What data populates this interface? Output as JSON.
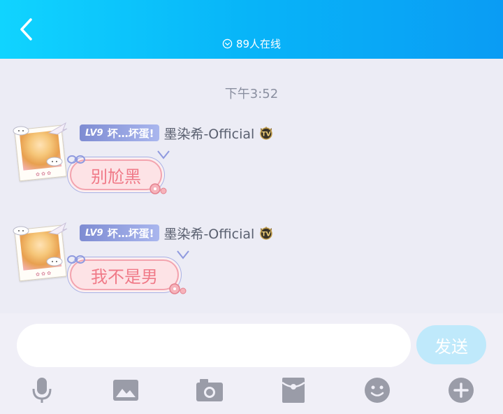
{
  "header": {
    "online_text": "89人在线"
  },
  "chat": {
    "timestamp": "下午3:52",
    "messages": [
      {
        "level": "LV9",
        "title": "坏…坏蛋!",
        "username": "墨染希-Official",
        "text": "别尬黑"
      },
      {
        "level": "LV9",
        "title": "坏…坏蛋!",
        "username": "墨染希-Official",
        "text": "我不是男"
      }
    ]
  },
  "composer": {
    "input_value": "",
    "send_label": "发送"
  },
  "toolbar": {
    "icons": [
      "microphone-icon",
      "image-icon",
      "camera-icon",
      "red-packet-icon",
      "emoji-icon",
      "plus-icon"
    ]
  },
  "colors": {
    "header_start": "#10d4ff",
    "header_end": "#0a9cf4",
    "badge": "#8e9cdf",
    "bubble_bg": "#fde3e6",
    "bubble_text": "#f07a88",
    "send_button": "#bfe9fb",
    "toolbar_icon": "#9a9ca8"
  }
}
